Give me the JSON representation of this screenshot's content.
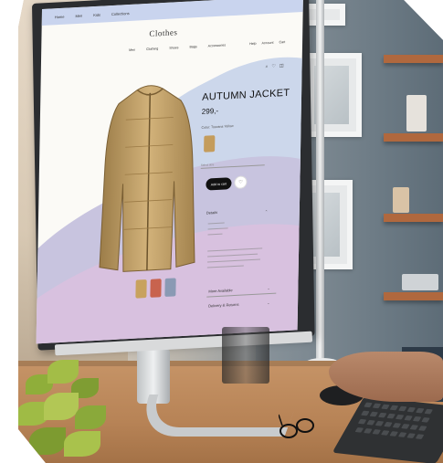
{
  "screen": {
    "topbar_links": [
      "Home",
      "Men",
      "Kids",
      "Collections"
    ],
    "brand": "Clothes",
    "nav_items": [
      "Men",
      "Clothing",
      "Shoes",
      "Bags",
      "Accessories"
    ],
    "nav_right": [
      "Help",
      "Account",
      "Cart"
    ],
    "icons": [
      "search-icon",
      "heart-icon",
      "bag-icon"
    ],
    "product": {
      "title": "AUTUMN JACKET",
      "price": "299,-",
      "color_label": "Color: Toscana Yellow",
      "size_placeholder": "Select size",
      "add_to_cart": "Add to cart",
      "details_heading": "Details",
      "accordions": [
        "More Available",
        "Delivery & Returns"
      ]
    },
    "thumbnail_colors": [
      "#c8a25e",
      "#c8634e",
      "#8a9ab4"
    ],
    "swatch_color": "#c49c5c"
  }
}
